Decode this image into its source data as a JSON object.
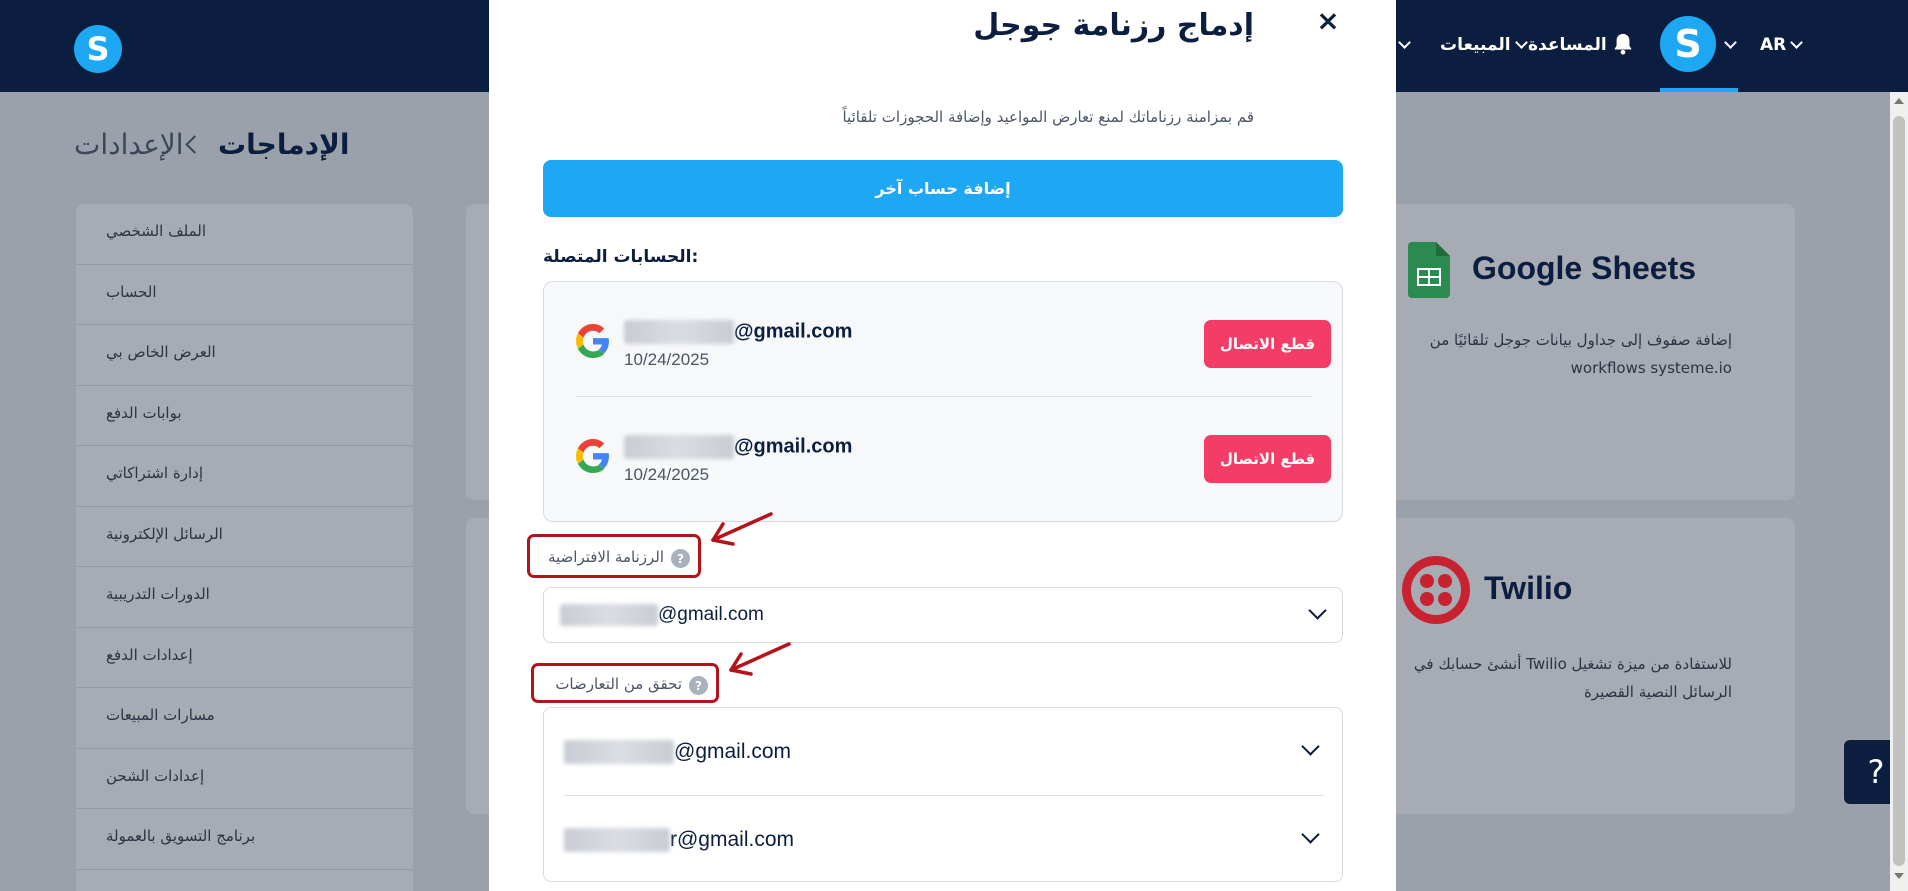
{
  "topbar": {
    "logo_letter": "S",
    "avatar_letter": "S",
    "lang": "AR",
    "help_label": "المساعدة",
    "sales_label": "المبيعات"
  },
  "breadcrumb": {
    "current": "الإدماجات",
    "parent": "الإعدادات"
  },
  "sidebar": {
    "items": [
      "الملف الشخصي",
      "الحساب",
      "العرض الخاص بي",
      "بوابات الدفع",
      "إدارة اشتراكاتي",
      "الرسائل الإلكترونية",
      "الدورات التدريبية",
      "إعدادات الدفع",
      "مسارات المبيعات",
      "إعدادات الشحن",
      "برنامج التسويق بالعمولة"
    ]
  },
  "cards": {
    "google_sheets": {
      "title": "Google Sheets",
      "desc": "إضافة صفوف إلى جداول بيانات جوجل تلقائيًا من workflows systeme.io"
    },
    "twilio": {
      "title": "Twilio",
      "desc": "للاستفادة من ميزة تشغيل Twilio أنشئ حسابك في الرسائل النصية القصيرة"
    }
  },
  "modal": {
    "title": "إدماج رزنامة جوجل",
    "close": "×",
    "subtitle": "قم بمزامنة رزناماتك لمنع تعارض المواعيد وإضافة الحجوزات تلقائياً",
    "add_account": "إضافة حساب آخر",
    "accounts_heading": "الحسابات المتصلة:",
    "accounts": [
      {
        "email_suffix": "@gmail.com",
        "date": "10/24/2025",
        "disconnect": "قطع الاتصال"
      },
      {
        "email_suffix": "@gmail.com",
        "date": "10/24/2025",
        "disconnect": "قطع الاتصال"
      }
    ],
    "default_calendar_label": "الرزنامة الافتراضية",
    "default_calendar_value": "@gmail.com",
    "check_conflicts_label": "تحقق من التعارضات",
    "conflict_calendars": [
      "@gmail.com",
      "r@gmail.com"
    ]
  },
  "help_button": "?",
  "colors": {
    "navy": "#0c1e3f",
    "primary": "#1ea7f2",
    "danger": "#f33d66",
    "highlight": "#b3141c"
  }
}
